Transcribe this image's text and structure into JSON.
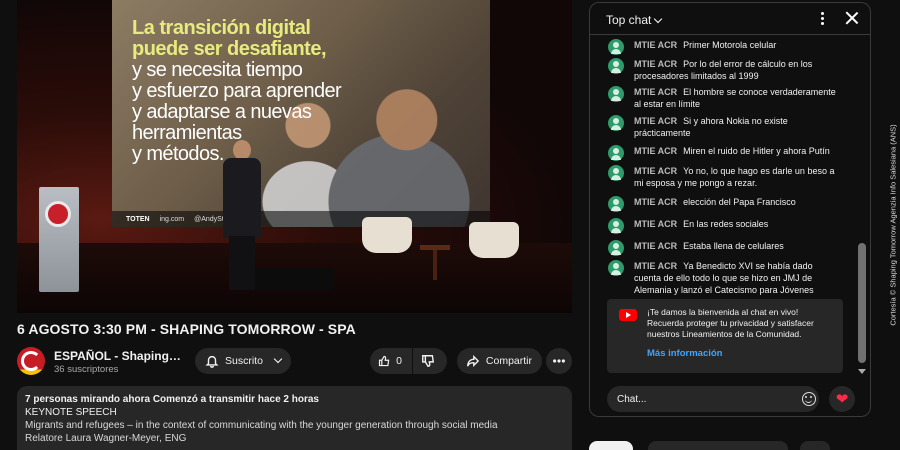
{
  "video": {
    "slide_line1": "La transición digital",
    "slide_line2": "puede ser desafiante,",
    "slide_line3": "y se necesita tiempo",
    "slide_line4": "y esfuerzo para aprender",
    "slide_line5": "y adaptarse a nuevas",
    "slide_line6": "herramientas",
    "slide_line7": "y métodos.",
    "footer_brand": "TOTEN",
    "footer_site": "ing.com",
    "footer_handle": "@AndyStalman"
  },
  "title": "6 AGOSTO 3:30 PM - SHAPING TOMORROW - SPA",
  "channel": {
    "name": "ESPAÑOL - ShapingTomorrow",
    "subscribers": "36 suscriptores"
  },
  "actions": {
    "subscribe": "Suscrito",
    "likes": "0",
    "share": "Compartir"
  },
  "description": {
    "meta": "7 personas mirando ahora  Comenzó a transmitir hace 2 horas",
    "line1": "KEYNOTE SPEECH",
    "line2": "Migrants and refugees – in the context of communicating with the younger generation through social media",
    "line3": "Relatore Laura Wagner-Meyer, ENG"
  },
  "chat": {
    "header": "Top chat",
    "messages": [
      {
        "author": "MTIE ACR",
        "text": "Primer Motorola celular"
      },
      {
        "author": "MTIE ACR",
        "text": "Por lo del error de cálculo en los procesadores limitados al 1999"
      },
      {
        "author": "MTIE ACR",
        "text": "El hombre se conoce verdaderamente al estar en límite"
      },
      {
        "author": "MTIE ACR",
        "text": "Si y ahora Nokia no existe prácticamente"
      },
      {
        "author": "MTIE ACR",
        "text": "Miren el ruido de Hitler y ahora Putín"
      },
      {
        "author": "MTIE ACR",
        "text": "Yo no, lo que hago es darle un beso a mi esposa y me pongo a rezar."
      },
      {
        "author": "MTIE ACR",
        "text": "elección del Papa Francisco"
      },
      {
        "author": "MTIE ACR",
        "text": "En las redes sociales"
      },
      {
        "author": "MTIE ACR",
        "text": "Estaba llena de celulares"
      },
      {
        "author": "MTIE ACR",
        "text": "Ya Benedicto XVI se había dado cuenta de ello todo lo que se hizo en JMJ de Alemania y lanzó el Catecismo para Jóvenes"
      }
    ],
    "welcome_text": "¡Te damos la bienvenida al chat en vivo! Recuerda proteger tu privacidad y satisfacer nuestros Lineamientos de la Comunidad.",
    "welcome_link": "Más información",
    "input_placeholder": "Chat..."
  },
  "credit": "Cortesía © Shaping Tomorrow Agenzia Info Salesiana (ANS)"
}
